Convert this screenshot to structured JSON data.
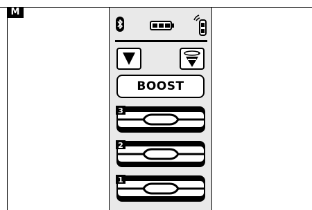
{
  "badge": "M",
  "boost_label": "BOOST",
  "icons": {
    "bluetooth": "bluetooth-icon",
    "battery": "battery-icon",
    "signal": "remote-signal-icon",
    "filter_down": "filter-down-icon",
    "filter_rotate": "filter-rotate-icon"
  },
  "levels": [
    {
      "number": "3"
    },
    {
      "number": "2"
    },
    {
      "number": "1"
    }
  ],
  "colors": {
    "screen_bg": "#e9e9e9",
    "ink": "#000000"
  }
}
